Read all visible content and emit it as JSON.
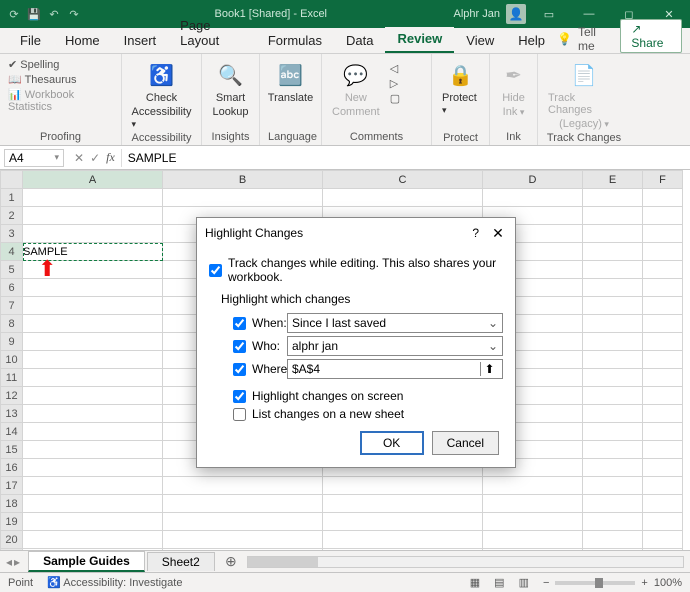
{
  "titlebar": {
    "doc": "Book1  [Shared]  -  Excel",
    "user": "Alphr Jan"
  },
  "tabs": [
    "File",
    "Home",
    "Insert",
    "Page Layout",
    "Formulas",
    "Data",
    "Review",
    "View",
    "Help"
  ],
  "active_tab": "Review",
  "tellme": "Tell me",
  "share": "Share",
  "ribbon": {
    "proofing": {
      "spelling": "Spelling",
      "thesaurus": "Thesaurus",
      "stats": "Workbook Statistics",
      "label": "Proofing"
    },
    "accessibility": {
      "check1": "Check",
      "check2": "Accessibility",
      "label": "Accessibility"
    },
    "insights": {
      "smart1": "Smart",
      "smart2": "Lookup",
      "label": "Insights"
    },
    "language": {
      "translate": "Translate",
      "label": "Language"
    },
    "comments": {
      "new1": "New",
      "new2": "Comment",
      "label": "Comments"
    },
    "protect": {
      "protect": "Protect",
      "label": "Protect"
    },
    "ink": {
      "hide1": "Hide",
      "hide2": "Ink",
      "label": "Ink"
    },
    "changes": {
      "t1": "Track Changes",
      "t2": "(Legacy)",
      "label": "Track Changes"
    }
  },
  "namebox": "A4",
  "formula": "SAMPLE",
  "cols": [
    "A",
    "B",
    "C",
    "D",
    "E",
    "F"
  ],
  "row_count": 21,
  "cell_a4": "SAMPLE",
  "sheets": {
    "active": "Sample Guides",
    "other": "Sheet2"
  },
  "status": {
    "mode": "Point",
    "access": "Accessibility: Investigate",
    "zoom": "100%"
  },
  "dialog": {
    "title": "Highlight Changes",
    "track": "Track changes while editing. This also shares your workbook.",
    "highlight": "Highlight which changes",
    "when_l": "When:",
    "when_v": "Since I last saved",
    "who_l": "Who:",
    "who_v": "alphr jan",
    "where_l": "Where:",
    "where_v": "$A$4",
    "opt_screen": "Highlight changes on screen",
    "opt_sheet": "List changes on a new sheet",
    "ok": "OK",
    "cancel": "Cancel"
  }
}
